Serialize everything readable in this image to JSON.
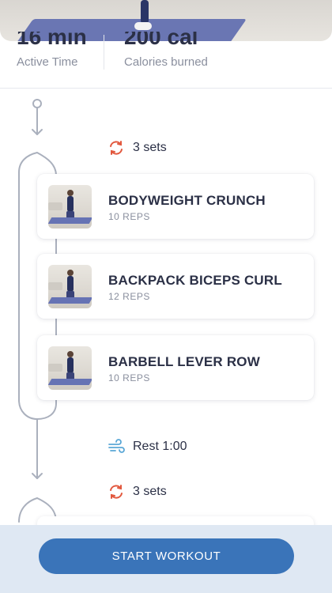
{
  "stats": {
    "active_time_value": "16 min",
    "active_time_label": "Active Time",
    "calories_value": "200 cal",
    "calories_label": "Calories burned"
  },
  "circuit1": {
    "sets_label": "3 sets",
    "exercises": [
      {
        "name": "BODYWEIGHT CRUNCH",
        "reps": "10 REPS"
      },
      {
        "name": "BACKPACK BICEPS CURL",
        "reps": "12 REPS"
      },
      {
        "name": "BARBELL LEVER ROW",
        "reps": "10 REPS"
      }
    ]
  },
  "rest": {
    "label": "Rest 1:00"
  },
  "circuit2": {
    "sets_label": "3 sets"
  },
  "actions": {
    "start_label": "START WORKOUT"
  },
  "icons": {
    "sets": "repeat-icon",
    "rest": "wind-icon"
  },
  "colors": {
    "accent": "#3a74b9",
    "sets_icon": "#e2583e",
    "rest_icon": "#5aa7d6",
    "bottom_bar": "#dfe8f3"
  }
}
